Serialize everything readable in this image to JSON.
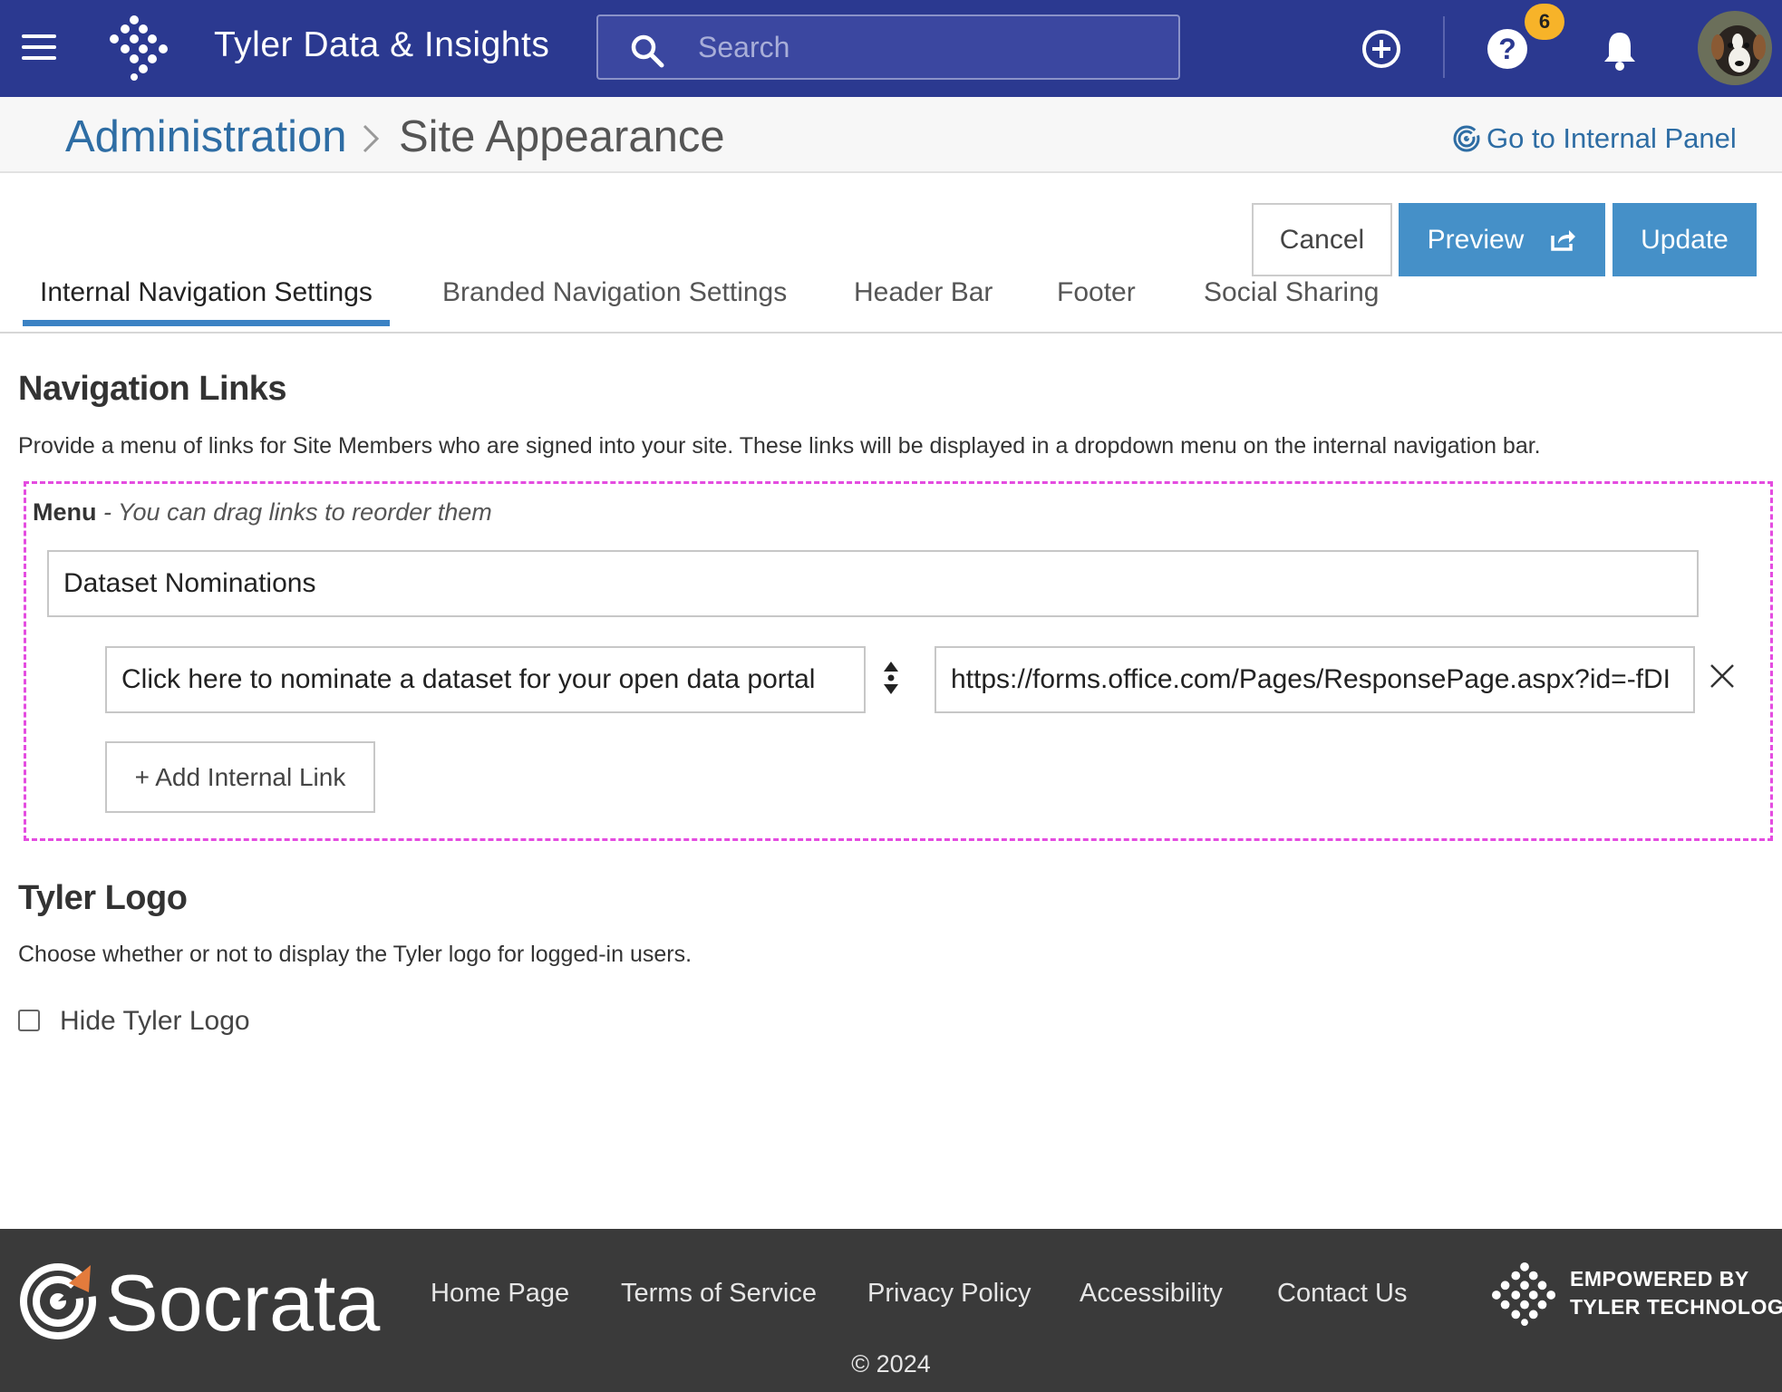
{
  "topbar": {
    "title": "Tyler Data & Insights",
    "search_placeholder": "Search",
    "notification_count": "6",
    "bg_color": "#2b3990"
  },
  "breadcrumb": {
    "parent": "Administration",
    "current": "Site Appearance",
    "internal_panel_link": "Go to Internal Panel"
  },
  "actions": {
    "cancel_label": "Cancel",
    "preview_label": "Preview",
    "update_label": "Update",
    "primary_color": "#4590c8"
  },
  "tabs": [
    {
      "label": "Internal Navigation Settings",
      "active": true
    },
    {
      "label": "Branded Navigation Settings",
      "active": false
    },
    {
      "label": "Header Bar",
      "active": false
    },
    {
      "label": "Footer",
      "active": false
    },
    {
      "label": "Social Sharing",
      "active": false
    }
  ],
  "navigation_links": {
    "heading": "Navigation Links",
    "description": "Provide a menu of links for Site Members who are signed into your site. These links will be displayed in a dropdown menu on the internal navigation bar.",
    "menu_label": "Menu",
    "menu_hint": "- You can drag links to reorder them",
    "menu_name_value": "Dataset Nominations",
    "link_label_value": "Click here to nominate a dataset for your open data portal",
    "link_url_value": "https://forms.office.com/Pages/ResponsePage.aspx?id=-fDI",
    "add_link_label": "+ Add Internal Link"
  },
  "tyler_logo": {
    "heading": "Tyler Logo",
    "description": "Choose whether or not to display the Tyler logo for logged-in users.",
    "checkbox_label": "Hide Tyler Logo",
    "checked": false
  },
  "footer": {
    "brand": "Socrata",
    "links": [
      "Home Page",
      "Terms of Service",
      "Privacy Policy",
      "Accessibility",
      "Contact Us"
    ],
    "empowered_line1": "EMPOWERED BY",
    "empowered_line2": "TYLER TECHNOLOGIES",
    "copyright": "© 2024"
  }
}
